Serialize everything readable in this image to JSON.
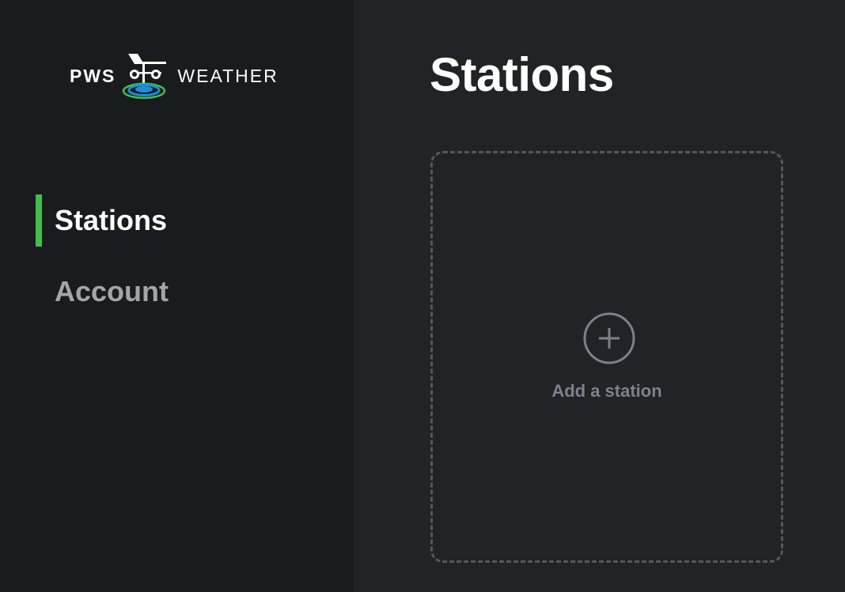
{
  "brand": {
    "word_left": "PWS",
    "word_right": "WEATHER",
    "mark_icon": "weather-vane-icon"
  },
  "sidebar": {
    "items": [
      {
        "label": "Stations",
        "active": true
      },
      {
        "label": "Account",
        "active": false
      }
    ]
  },
  "main": {
    "title": "Stations",
    "add_card": {
      "icon": "plus-circle-icon",
      "label": "Add a station"
    }
  },
  "colors": {
    "sidebar_bg": "#1a1b1e",
    "main_bg": "#222326",
    "accent": "#3fbe4f",
    "muted_text": "#a3a5a9",
    "dashed_border": "#55575c",
    "add_label": "#7d8189"
  }
}
